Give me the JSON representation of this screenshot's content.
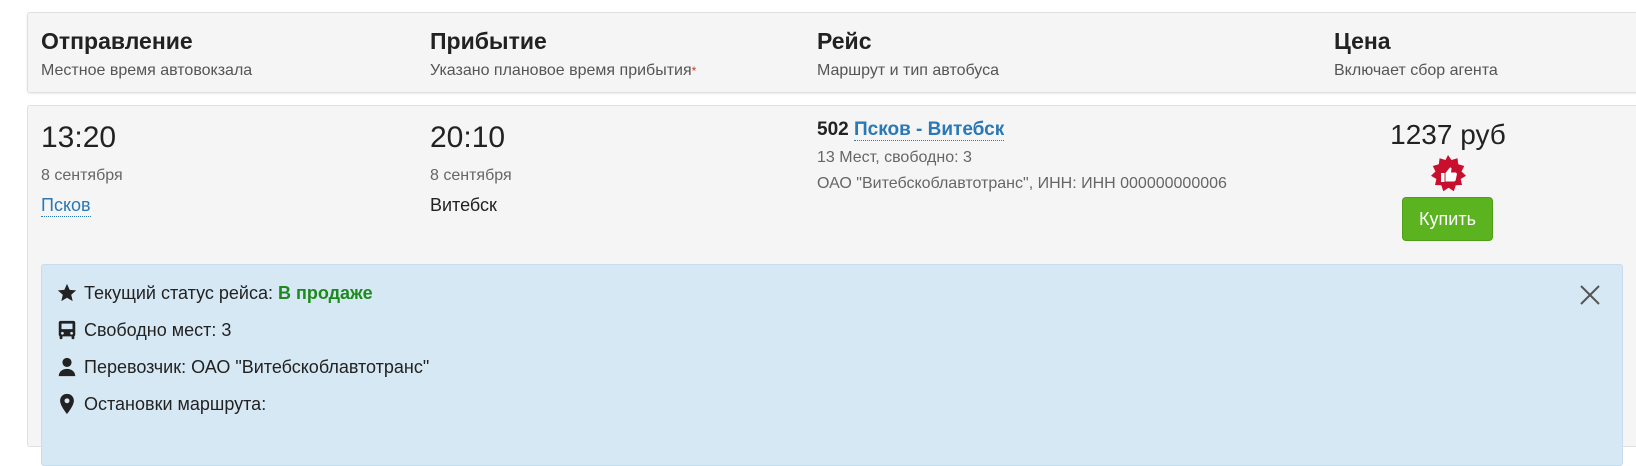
{
  "header": {
    "departure": {
      "title": "Отправление",
      "subtitle": "Местное время автовокзала"
    },
    "arrival": {
      "title": "Прибытие",
      "subtitle": "Указано плановое время прибытия",
      "required_mark": "*"
    },
    "trip": {
      "title": "Рейс",
      "subtitle": "Маршрут и тип автобуса"
    },
    "price": {
      "title": "Цена",
      "subtitle": "Включает сбор агента"
    }
  },
  "trip": {
    "departure": {
      "time": "13:20",
      "date": "8 сентября",
      "city": "Псков"
    },
    "arrival": {
      "time": "20:10",
      "date": "8 сентября",
      "city": "Витебск"
    },
    "route": {
      "number": "502",
      "name": "Псков - Витебск",
      "seats": "13 Мест, свободно: 3",
      "carrier": "ОАО \"Витебскоблавтотранс\", ИНН: ИНН 000000000006"
    },
    "price": "1237 руб",
    "buy_label": "Купить"
  },
  "info": {
    "status_label": "Текущий статус рейса:",
    "status_value": "В продаже",
    "seats": "Свободно мест: 3",
    "carrier": "Перевозчик: ОАО \"Витебскоблавтотранс\"",
    "stops": "Остановки маршрута:"
  },
  "colors": {
    "link": "#2a78b5",
    "buy": "#5cb320",
    "status": "#1d8a1d",
    "badge": "#c8102e",
    "panel": "#d7e8f5"
  },
  "icons": {
    "badge": "thumbs-up-badge-icon",
    "status": "star-icon",
    "seats": "bus-icon",
    "carrier": "user-icon",
    "stops": "map-marker-icon",
    "close": "close-icon"
  }
}
